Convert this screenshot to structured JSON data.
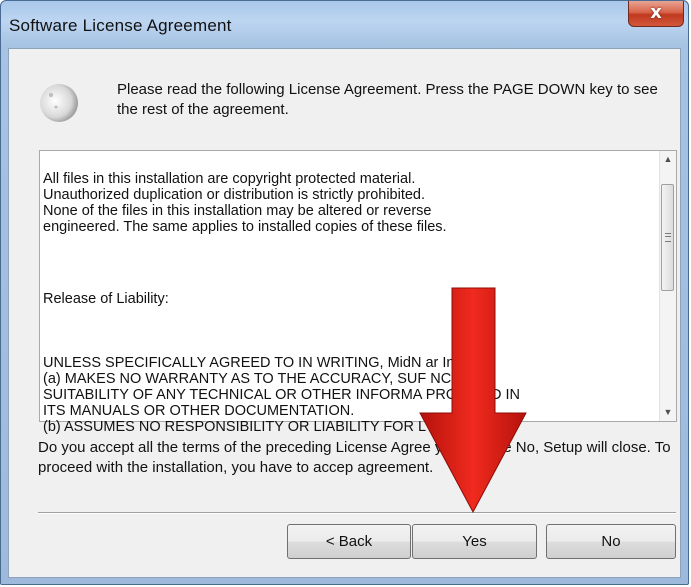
{
  "window": {
    "title": "Software License Agreement",
    "close_glyph": "x"
  },
  "header": {
    "icon": "moon-setup-icon",
    "instruction": "Please read the following License Agreement. Press the PAGE DOWN key to see the rest of the agreement."
  },
  "license": {
    "paragraph1": "All files in this installation are copyright protected material.\nUnauthorized duplication or distribution is strictly prohibited.\nNone of the files in this installation may be altered or reverse\nengineered. The same applies to installed copies of these files.",
    "heading": "Release of Liability:",
    "paragraph2": "UNLESS SPECIFICALLY AGREED TO IN WRITING, MidN           ar Inc.\n(a) MAKES NO WARRANTY AS TO THE ACCURACY, SUF           NCY OR\nSUITABILITY OF ANY TECHNICAL OR OTHER INFORMA           PROVIDED IN\nITS MANUALS OR OTHER DOCUMENTATION.\n(b) ASSUMES NO RESPONSIBILITY OR LIABILITY FOR L           S,",
    "scroll_fraction": 0.25
  },
  "question": "Do you accept all the terms of the preceding License Agree            you choose No, Setup will close. To proceed with the installation, you have to accep          agreement.",
  "buttons": {
    "back": "< Back",
    "yes": "Yes",
    "no": "No"
  },
  "overlay": {
    "arrow_icon": "red-down-arrow-icon",
    "arrow_color": "#e8231b"
  },
  "colors": {
    "title_bar": "#b4cfee",
    "close_button": "#d2583c",
    "client_bg": "#f0f0f0"
  }
}
